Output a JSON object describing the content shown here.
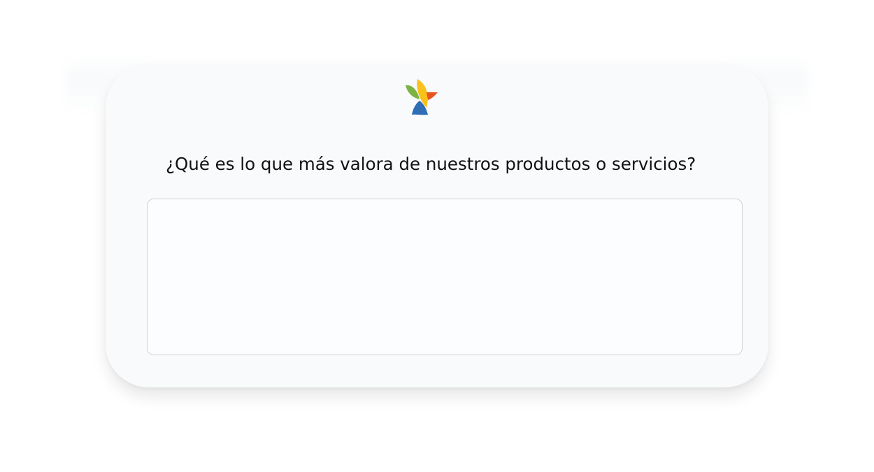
{
  "survey": {
    "question": "¿Qué es lo que más valora de nuestros productos o servicios?",
    "answer_value": "",
    "answer_placeholder": ""
  },
  "brand": {
    "logo_icon": "bird-logo-icon",
    "colors": [
      "#7cb342",
      "#f9c21a",
      "#e8541e",
      "#2f6db5"
    ]
  },
  "theme": {
    "card_background": "#f8fafc",
    "input_border": "#cfd3d8",
    "text": "#111111"
  }
}
